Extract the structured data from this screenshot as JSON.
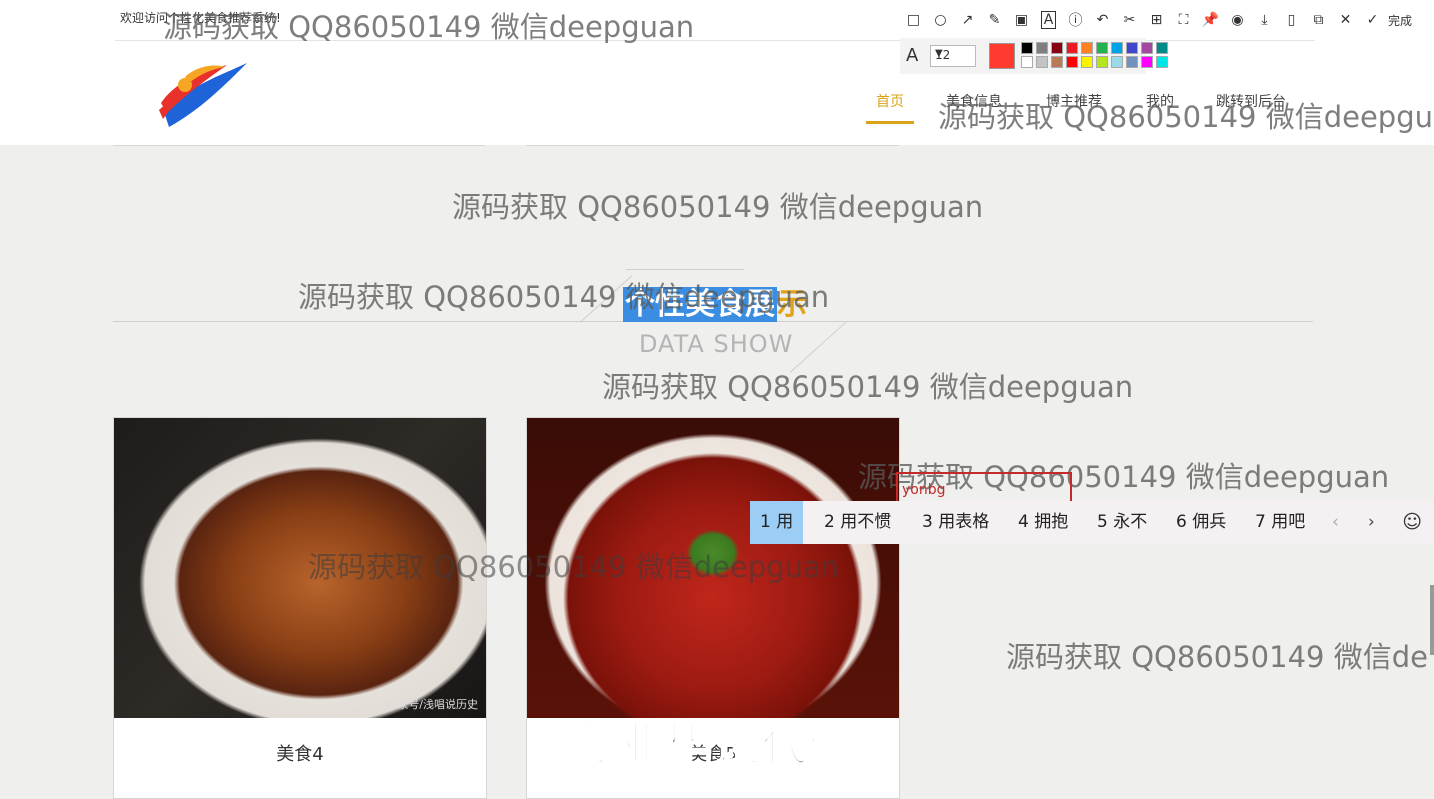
{
  "header": {
    "welcome": "欢迎访问个性化美食推荐系统!",
    "nav": [
      {
        "label": "首页",
        "active": true
      },
      {
        "label": "美食信息"
      },
      {
        "label": "博主推荐"
      },
      {
        "label": "我的"
      },
      {
        "label": "跳转到后台"
      }
    ],
    "accent_color": "#d9a31a"
  },
  "section": {
    "title_selected": "个性美食展",
    "title_rest": "示",
    "subtitle": "DATA SHOW"
  },
  "cards": [
    {
      "caption": "美食4",
      "credit": "百家号/浅唱说历史"
    },
    {
      "caption": "美食5"
    }
  ],
  "watermarks": {
    "text": "源码获取 QQ86050149 微信deepguan",
    "cut_text": "源码获取 QQ86050149 微信deepgu",
    "cut_text2": "源码获取 QQ86050149 微信de",
    "stamp": "专业毕设代做"
  },
  "annotation_toolbar": {
    "icons": [
      "rectangle-icon",
      "ellipse-icon",
      "arrow-icon",
      "pen-icon",
      "mosaic-icon",
      "text-icon",
      "number-icon",
      "undo-icon",
      "crop-icon",
      "ocr-icon",
      "screenshot-icon",
      "pin-icon",
      "record-icon",
      "download-icon",
      "phone-icon",
      "bookmark-icon",
      "close-icon",
      "check-icon"
    ],
    "done_label": "完成",
    "font_size": "12",
    "current_color": "#ff3b30",
    "palette_top": [
      "#000000",
      "#7f7f7f",
      "#880015",
      "#ed1c24",
      "#ff7f27",
      "#22b14c",
      "#00a2e8",
      "#3f48cc",
      "#a349a4",
      "#008b8b"
    ],
    "palette_bottom": [
      "#ffffff",
      "#c3c3c3",
      "#b97a57",
      "#ff0000",
      "#fff200",
      "#b5e61d",
      "#99d9ea",
      "#7092be",
      "#ff00ff",
      "#00e5e5"
    ]
  },
  "ime": {
    "pinyin": "yonbg",
    "candidates": [
      "1 用",
      "2 用不惯",
      "3 用表格",
      "4 拥抱",
      "5 永不",
      "6 佣兵",
      "7 用吧"
    ]
  }
}
